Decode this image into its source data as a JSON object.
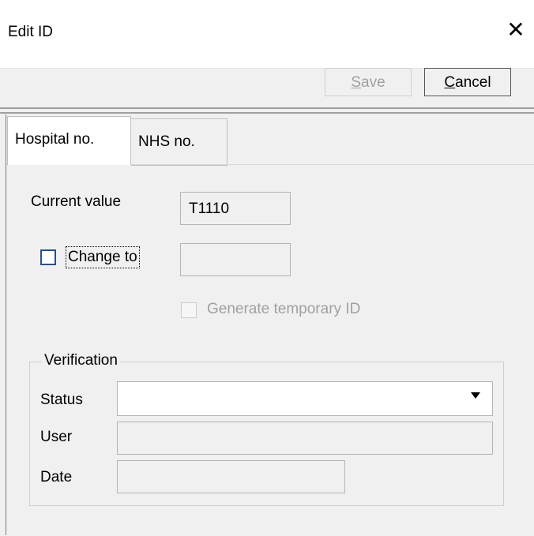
{
  "window": {
    "title": "Edit ID",
    "close_glyph": "✕"
  },
  "toolbar": {
    "save": {
      "mnemonic": "S",
      "rest": "ave"
    },
    "cancel": {
      "mnemonic": "C",
      "rest": "ancel"
    }
  },
  "tabs": [
    {
      "label": "Hospital no.",
      "selected": true
    },
    {
      "label": "NHS no.",
      "selected": false
    }
  ],
  "form": {
    "current_value_label": "Current value",
    "current_value": "T1110",
    "change_to_label": "Change to",
    "change_to_value": "",
    "change_to_checked": false,
    "generate_temp_label": "Generate temporary ID",
    "generate_temp_checked": false
  },
  "verification": {
    "legend": "Verification",
    "status_label": "Status",
    "status_value": "",
    "user_label": "User",
    "user_value": "",
    "date_label": "Date",
    "date_value": ""
  },
  "colors": {
    "checkbox_border": "#2c4f86",
    "disabled_text": "#a0a0a0"
  }
}
